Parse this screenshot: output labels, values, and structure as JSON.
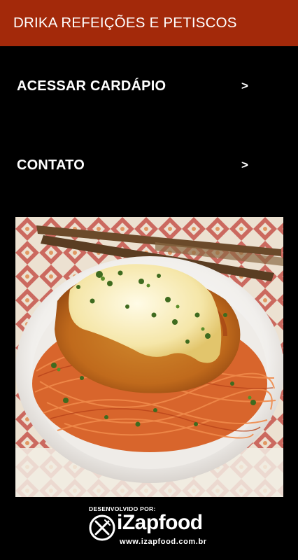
{
  "header": {
    "title": "DRIKA REFEIÇÕES E PETISCOS"
  },
  "menu": {
    "items": [
      {
        "label": "ACESSAR CARDÁPIO",
        "chevron": ">"
      },
      {
        "label": "CONTATO",
        "chevron": ">"
      }
    ]
  },
  "footer": {
    "caption": "DESENVOLVIDO POR:",
    "brand": "iZapfood",
    "url": "www.izapfood.com.br"
  },
  "colors": {
    "appbar": "#a3290a",
    "background": "#000000",
    "text": "#ffffff"
  }
}
